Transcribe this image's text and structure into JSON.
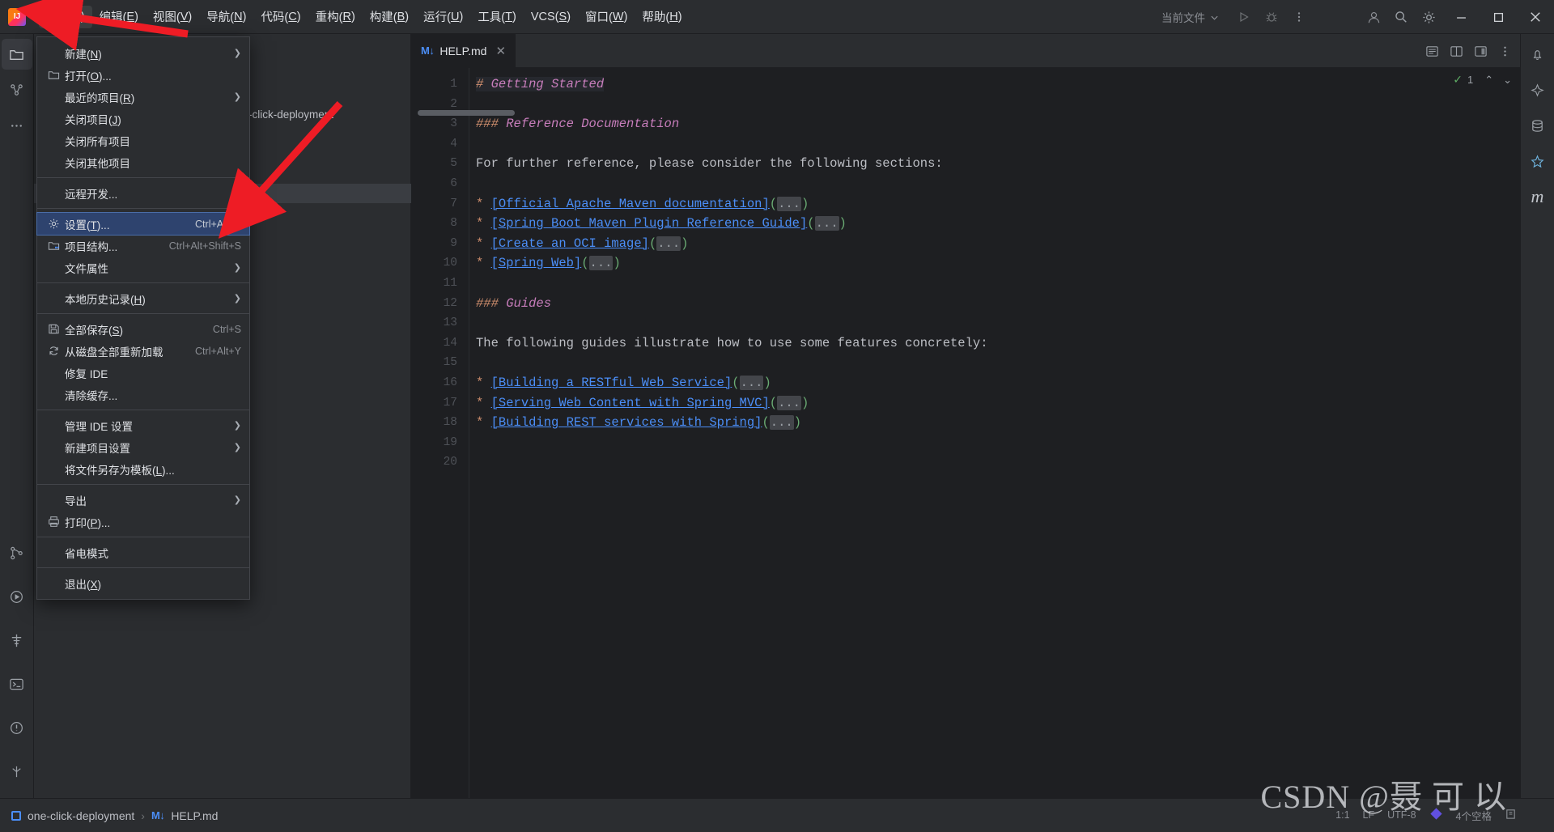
{
  "app": {
    "logo_icon": "intellij-idea-logo"
  },
  "menubar": {
    "items": [
      {
        "label": "文件",
        "mnemonic": "F",
        "active": true
      },
      {
        "label": "编辑",
        "mnemonic": "E",
        "active": false
      },
      {
        "label": "视图",
        "mnemonic": "V",
        "active": false
      },
      {
        "label": "导航",
        "mnemonic": "N",
        "active": false
      },
      {
        "label": "代码",
        "mnemonic": "C",
        "active": false
      },
      {
        "label": "重构",
        "mnemonic": "R",
        "active": false
      },
      {
        "label": "构建",
        "mnemonic": "B",
        "active": false
      },
      {
        "label": "运行",
        "mnemonic": "U",
        "active": false
      },
      {
        "label": "工具",
        "mnemonic": "T",
        "active": false
      },
      {
        "label": "VCS",
        "mnemonic": "S",
        "active": false
      },
      {
        "label": "窗口",
        "mnemonic": "W",
        "active": false
      },
      {
        "label": "帮助",
        "mnemonic": "H",
        "active": false
      }
    ]
  },
  "toolbar_right": {
    "run_config_label": "当前文件",
    "run_config_chevron": "chevron-down-icon",
    "run_icon": "run-triangle-icon",
    "debug_icon": "debug-bug-icon",
    "more_icon": "more-vertical-icon",
    "account_icon": "user-account-icon",
    "search_icon": "search-icon",
    "settings_icon": "gear-icon",
    "minimize_icon": "window-minimize-icon",
    "maximize_icon": "window-maximize-icon",
    "close_icon": "window-close-icon"
  },
  "file_menu": {
    "groups": [
      [
        {
          "label": "新建",
          "mnemonic": "N",
          "icon": null,
          "shortcut": null,
          "submenu": true,
          "selected": false
        },
        {
          "label": "打开",
          "mnemonic": "O",
          "suffix": "...",
          "icon": "folder-icon",
          "shortcut": null,
          "submenu": false,
          "selected": false
        },
        {
          "label": "最近的项目",
          "mnemonic": "R",
          "icon": null,
          "shortcut": null,
          "submenu": true,
          "selected": false
        },
        {
          "label": "关闭项目",
          "mnemonic": "J",
          "icon": null,
          "shortcut": null,
          "submenu": false,
          "selected": false
        },
        {
          "label": "关闭所有项目",
          "mnemonic": null,
          "icon": null,
          "shortcut": null,
          "submenu": false,
          "selected": false
        },
        {
          "label": "关闭其他项目",
          "mnemonic": null,
          "icon": null,
          "shortcut": null,
          "submenu": false,
          "selected": false
        }
      ],
      [
        {
          "label": "远程开发",
          "mnemonic": null,
          "suffix": "...",
          "icon": null,
          "shortcut": null,
          "submenu": false,
          "selected": false
        }
      ],
      [
        {
          "label": "设置",
          "mnemonic": "T",
          "suffix": "...",
          "icon": "gear-icon",
          "shortcut": "Ctrl+Alt+S",
          "submenu": false,
          "selected": true
        },
        {
          "label": "项目结构",
          "mnemonic": null,
          "suffix": "...",
          "icon": "project-structure-icon",
          "shortcut": "Ctrl+Alt+Shift+S",
          "submenu": false,
          "selected": false
        },
        {
          "label": "文件属性",
          "mnemonic": null,
          "icon": null,
          "shortcut": null,
          "submenu": true,
          "selected": false
        }
      ],
      [
        {
          "label": "本地历史记录",
          "mnemonic": "H",
          "icon": null,
          "shortcut": null,
          "submenu": true,
          "selected": false
        }
      ],
      [
        {
          "label": "全部保存",
          "mnemonic": "S",
          "icon": "save-icon",
          "shortcut": "Ctrl+S",
          "submenu": false,
          "selected": false
        },
        {
          "label": "从磁盘全部重新加载",
          "mnemonic": null,
          "icon": "refresh-icon",
          "shortcut": "Ctrl+Alt+Y",
          "submenu": false,
          "selected": false
        },
        {
          "label": "修复 IDE",
          "mnemonic": null,
          "icon": null,
          "shortcut": null,
          "submenu": false,
          "selected": false
        },
        {
          "label": "清除缓存",
          "mnemonic": null,
          "suffix": "...",
          "icon": null,
          "shortcut": null,
          "submenu": false,
          "selected": false
        }
      ],
      [
        {
          "label": "管理 IDE 设置",
          "mnemonic": null,
          "icon": null,
          "shortcut": null,
          "submenu": true,
          "selected": false
        },
        {
          "label": "新建项目设置",
          "mnemonic": null,
          "icon": null,
          "shortcut": null,
          "submenu": true,
          "selected": false
        },
        {
          "label": "将文件另存为模板",
          "mnemonic": "L",
          "suffix": "...",
          "icon": null,
          "shortcut": null,
          "submenu": false,
          "selected": false
        }
      ],
      [
        {
          "label": "导出",
          "mnemonic": null,
          "icon": null,
          "shortcut": null,
          "submenu": true,
          "selected": false
        },
        {
          "label": "打印",
          "mnemonic": "P",
          "suffix": "...",
          "icon": "printer-icon",
          "shortcut": null,
          "submenu": false,
          "selected": false
        }
      ],
      [
        {
          "label": "省电模式",
          "mnemonic": null,
          "icon": null,
          "shortcut": null,
          "submenu": false,
          "selected": false
        }
      ],
      [
        {
          "label": "退出",
          "mnemonic": "X",
          "icon": null,
          "shortcut": null,
          "submenu": false,
          "selected": false
        }
      ]
    ]
  },
  "project_panel": {
    "partial_text": "-click-deployment"
  },
  "editor": {
    "tab": {
      "label": "HELP.md",
      "file_icon": "markdown-file-icon",
      "close_icon": "close-icon"
    },
    "tabbar_icons": [
      "preview-icon",
      "split-editor-icon",
      "editor-layout-icon",
      "more-vertical-icon"
    ],
    "inspection": {
      "count": "1",
      "check_icon": "checkmark-icon",
      "up_icon": "chevron-up-icon",
      "down_icon": "chevron-down-icon"
    },
    "lines": [
      {
        "n": "1",
        "type": "h1",
        "hash": "#",
        "text": "Getting Started",
        "highlight": true
      },
      {
        "n": "2",
        "type": "blank"
      },
      {
        "n": "3",
        "type": "h3",
        "hash": "###",
        "text": "Reference Documentation"
      },
      {
        "n": "4",
        "type": "blank"
      },
      {
        "n": "5",
        "type": "plain",
        "text": "For further reference, please consider the following sections:"
      },
      {
        "n": "6",
        "type": "blank"
      },
      {
        "n": "7",
        "type": "link",
        "link": "[Official Apache Maven documentation]",
        "dots": "..."
      },
      {
        "n": "8",
        "type": "link",
        "link": "[Spring Boot Maven Plugin Reference Guide]",
        "dots": "..."
      },
      {
        "n": "9",
        "type": "link",
        "link": "[Create an OCI image]",
        "dots": "..."
      },
      {
        "n": "10",
        "type": "link",
        "link": "[Spring Web]",
        "dots": "..."
      },
      {
        "n": "11",
        "type": "blank"
      },
      {
        "n": "12",
        "type": "h3",
        "hash": "###",
        "text": "Guides"
      },
      {
        "n": "13",
        "type": "blank"
      },
      {
        "n": "14",
        "type": "plain",
        "text": "The following guides illustrate how to use some features concretely:"
      },
      {
        "n": "15",
        "type": "blank"
      },
      {
        "n": "16",
        "type": "link",
        "link": "[Building a RESTful Web Service]",
        "dots": "..."
      },
      {
        "n": "17",
        "type": "link",
        "link": "[Serving Web Content with Spring MVC]",
        "dots": "..."
      },
      {
        "n": "18",
        "type": "link",
        "link": "[Building REST services with Spring]",
        "dots": "..."
      },
      {
        "n": "19",
        "type": "blank"
      },
      {
        "n": "20",
        "type": "blank"
      }
    ],
    "bullet": "*",
    "paren_open": "(",
    "paren_close": ")"
  },
  "left_strip": {
    "icons": [
      "project-folder-icon",
      "structure-icon",
      "more-horizontal-icon",
      "version-control-icon",
      "run-icon",
      "build-icon",
      "terminal-icon",
      "problems-icon",
      "git-branch-icon"
    ]
  },
  "right_strip": {
    "icons": [
      "notifications-bell-icon",
      "ai-assistant-icon",
      "database-icon",
      "bookmarks-icon",
      "maven-icon"
    ]
  },
  "breadcrumb": {
    "project_icon": "project-module-icon",
    "project": "one-click-deployment",
    "separator": "›",
    "file_icon": "markdown-file-icon",
    "file": "HELP.md"
  },
  "status_bar": {
    "caret": "1:1",
    "line_separator": "LF",
    "encoding": "UTF-8",
    "git_icon": "git-logo-icon",
    "indent": "4个空格",
    "lock_icon": "read-write-lock-icon"
  },
  "watermark": {
    "text": "CSDN @聂 可 以",
    "sub": "以"
  },
  "colors": {
    "accent_blue": "#4b8ef7",
    "selection_blue": "#2e436e",
    "bg_panel": "#2b2d30",
    "bg_editor": "#1e1f22",
    "annotation_red": "#ee1c25",
    "heading_purple": "#c77dbb",
    "hash_orange": "#cf8e6d",
    "paren_green": "#6aab73"
  }
}
